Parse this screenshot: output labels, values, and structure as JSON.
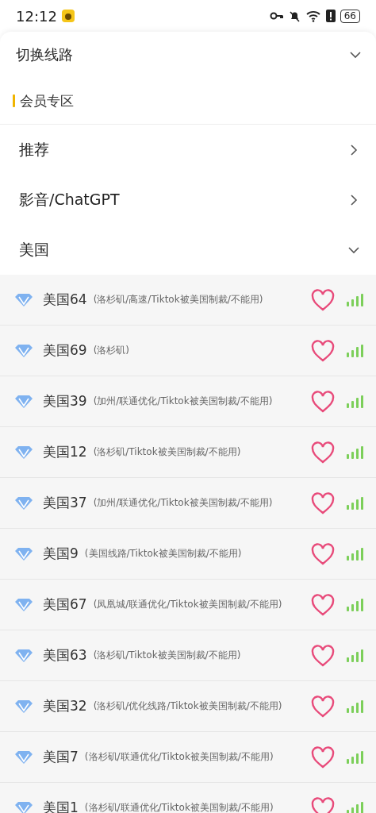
{
  "status_bar": {
    "time": "12:12",
    "battery": "66"
  },
  "header": {
    "title": "切换线路",
    "expanded": true
  },
  "zone": {
    "title": "会员专区"
  },
  "groups": [
    {
      "title": "推荐",
      "expanded": false
    },
    {
      "title": "影音/ChatGPT",
      "expanded": false
    },
    {
      "title": "美国",
      "expanded": true,
      "servers": [
        {
          "name": "美国64",
          "note": "(洛杉矶/高速/Tiktok被美国制裁/不能用)",
          "favorite": false
        },
        {
          "name": "美国69",
          "note": "(洛杉矶)",
          "favorite": false
        },
        {
          "name": "美国39",
          "note": "(加州/联通优化/Tiktok被美国制裁/不能用)",
          "favorite": false
        },
        {
          "name": "美国12",
          "note": "(洛杉矶/Tiktok被美国制裁/不能用)",
          "favorite": false
        },
        {
          "name": "美国37",
          "note": "(加州/联通优化/Tiktok被美国制裁/不能用)",
          "favorite": false
        },
        {
          "name": "美国9",
          "note": "(美国线路/Tiktok被美国制裁/不能用)",
          "favorite": false
        },
        {
          "name": "美国67",
          "note": "(凤凰城/联通优化/Tiktok被美国制裁/不能用)",
          "favorite": false
        },
        {
          "name": "美国63",
          "note": "(洛杉矶/Tiktok被美国制裁/不能用)",
          "favorite": false
        },
        {
          "name": "美国32",
          "note": "(洛杉矶/优化线路/Tiktok被美国制裁/不能用)",
          "favorite": false
        },
        {
          "name": "美国7",
          "note": "(洛杉矶/联通优化/Tiktok被美国制裁/不能用)",
          "favorite": false
        },
        {
          "name": "美国1",
          "note": "(洛杉矶/联通优化/Tiktok被美国制裁/不能用)",
          "favorite": false
        }
      ]
    }
  ]
}
